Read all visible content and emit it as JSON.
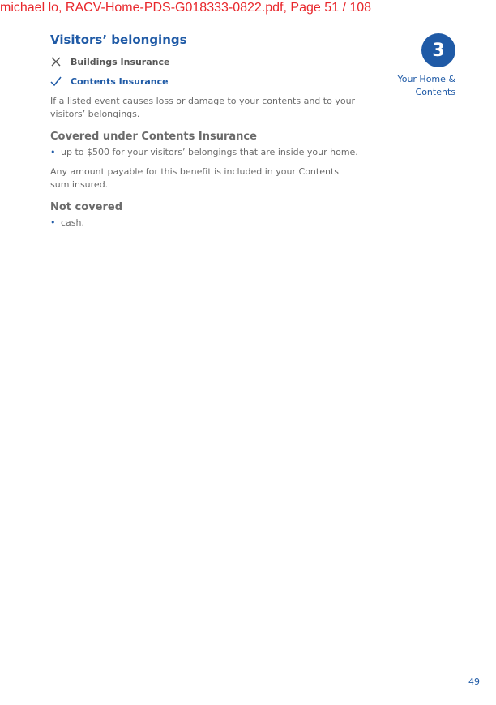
{
  "watermark": "michael lo, RACV-Home-PDS-G018333-0822.pdf, Page 51 / 108",
  "section": {
    "title": "Visitors’ belongings",
    "cover_types": [
      {
        "label": "Buildings Insurance",
        "icon": "cross-icon",
        "status": "not-covered"
      },
      {
        "label": "Contents Insurance",
        "icon": "check-icon",
        "status": "covered"
      }
    ],
    "intro": "If a listed event causes loss or damage to your contents and to your visitors’ belongings.",
    "covered": {
      "heading": "Covered under Contents Insurance",
      "items": [
        "up to $500 for your visitors’ belongings that are inside your home."
      ]
    },
    "note": "Any amount payable for this benefit is included in your Contents sum insured.",
    "not_covered": {
      "heading": "Not covered",
      "items": [
        "cash."
      ]
    }
  },
  "chapter": {
    "number": "3",
    "label_line1": "Your Home &",
    "label_line2": "Contents"
  },
  "page_number": "49",
  "colors": {
    "brand_blue": "#1f5aa6",
    "body_text": "#6b6b6b",
    "watermark_red": "#e8262b"
  }
}
